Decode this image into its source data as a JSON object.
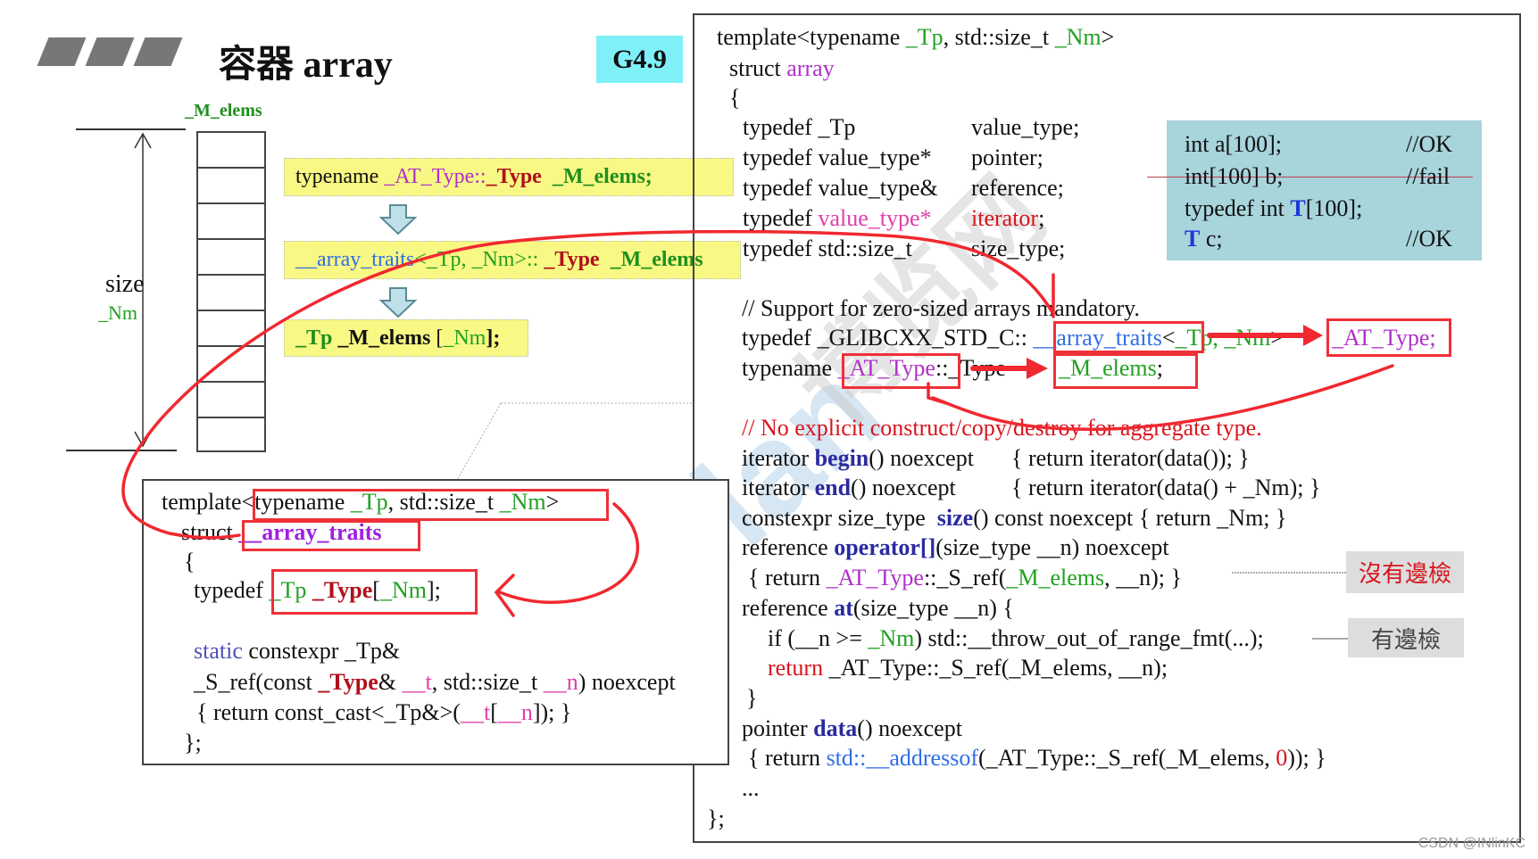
{
  "header": {
    "title": "容器 array",
    "version_badge": "G4.9"
  },
  "diagram": {
    "elems_label": "_M_elems",
    "size_label": "size",
    "size_var": "_Nm",
    "cell_count": 9
  },
  "yellow_boxes": [
    [
      [
        "typename ",
        "k"
      ],
      [
        "_AT_Type::",
        "p"
      ],
      [
        "_Type",
        "drb"
      ],
      [
        "  ",
        "k"
      ],
      [
        "_M_elems;",
        "gb"
      ]
    ],
    [
      [
        "__array_traits",
        "lb"
      ],
      [
        "<_Tp, _Nm>:: ",
        "g"
      ],
      [
        "_Type",
        "drb"
      ],
      [
        "  ",
        "k"
      ],
      [
        "_M_elems",
        "gb"
      ]
    ],
    [
      [
        "_Tp",
        "gb"
      ],
      [
        " _M_elems ",
        "kb"
      ],
      [
        "[",
        "k"
      ],
      [
        "_Nm",
        "g"
      ],
      [
        "];",
        "kb"
      ]
    ]
  ],
  "left_code": {
    "lines": [
      [
        [
          "template<typename ",
          "k"
        ],
        [
          "_Tp",
          "g"
        ],
        [
          ", std::size_t ",
          "k"
        ],
        [
          "_Nm",
          "g"
        ],
        [
          ">",
          "k"
        ]
      ],
      [
        [
          "struct ",
          "k"
        ],
        [
          "__array_traits",
          "pb"
        ]
      ],
      [
        [
          "{",
          "k"
        ]
      ],
      [
        [
          "typedef ",
          "k"
        ],
        [
          "_Tp ",
          "g"
        ],
        [
          "_Type",
          "drb"
        ],
        [
          "[",
          "k"
        ],
        [
          "_Nm",
          "g"
        ],
        [
          "];",
          "k"
        ]
      ],
      [
        [
          "static",
          "pu"
        ],
        [
          " constexpr _Tp&",
          "k"
        ]
      ],
      [
        [
          "_S_ref(const ",
          "k"
        ],
        [
          "_Type",
          "drb"
        ],
        [
          "& ",
          "k"
        ],
        [
          "__t",
          "pk"
        ],
        [
          ", std::size_t ",
          "k"
        ],
        [
          "__n",
          "pk"
        ],
        [
          ") noexcept",
          "k"
        ]
      ],
      [
        [
          "{ return const_cast<_Tp&>(",
          "k"
        ],
        [
          "__t",
          "pk"
        ],
        [
          "[",
          "k"
        ],
        [
          "__n",
          "pk"
        ],
        [
          "]); }",
          "k"
        ]
      ],
      [
        [
          "};",
          "k"
        ]
      ]
    ]
  },
  "right_code": {
    "lines": [
      [
        [
          "template<typename ",
          "k"
        ],
        [
          "_Tp",
          "g"
        ],
        [
          ", std::size_t ",
          "k"
        ],
        [
          "_Nm",
          "g"
        ],
        [
          ">",
          "k"
        ]
      ],
      [
        [
          "struct ",
          "k"
        ],
        [
          "array",
          "p"
        ]
      ],
      [
        [
          "{",
          "k"
        ]
      ],
      [
        [
          "typedef _Tp",
          "k"
        ]
      ],
      [
        [
          "value_type;",
          "k"
        ]
      ],
      [
        [
          "typedef value_type*",
          "k"
        ]
      ],
      [
        [
          "pointer;",
          "k"
        ]
      ],
      [
        [
          "typedef value_type&",
          "k"
        ]
      ],
      [
        [
          "reference;",
          "k"
        ]
      ],
      [
        [
          "typedef ",
          "k"
        ],
        [
          "value_type*",
          "pk"
        ]
      ],
      [
        [
          "iterator",
          "r"
        ],
        [
          ";",
          "k"
        ]
      ],
      [
        [
          "typedef std::size_t",
          "k"
        ]
      ],
      [
        [
          "size_type;",
          "k"
        ]
      ],
      [
        [
          "// Support for zero-sized arrays mandatory.",
          "k"
        ]
      ],
      [
        [
          "typedef _GLIBCXX_STD_C:: ",
          "k"
        ],
        [
          "__array_traits",
          "lb"
        ],
        [
          "<",
          "k"
        ],
        [
          "_Tp, _Nm",
          "g"
        ],
        [
          ">",
          "k"
        ]
      ],
      [
        [
          "_AT_Type;",
          "p"
        ]
      ],
      [
        [
          "typename ",
          "k"
        ],
        [
          "_AT_Type",
          "p"
        ],
        [
          "::_Type",
          "k"
        ]
      ],
      [
        [
          "_M_elems",
          "g"
        ],
        [
          ";",
          "k"
        ]
      ],
      [
        [
          "// No explicit construct/copy/destroy for aggregate type.",
          "r"
        ]
      ],
      [
        [
          "iterator ",
          "k"
        ],
        [
          "begin",
          "b"
        ],
        [
          "() noexcept",
          "k"
        ]
      ],
      [
        [
          "{ return iterator(data()); }",
          "k"
        ]
      ],
      [
        [
          "iterator ",
          "k"
        ],
        [
          "end",
          "b"
        ],
        [
          "() noexcept",
          "k"
        ]
      ],
      [
        [
          "{ return iterator(data() + _Nm); }",
          "k"
        ]
      ],
      [
        [
          "constexpr size_type  ",
          "k"
        ],
        [
          "size",
          "b"
        ],
        [
          "() const noexcept { return _Nm; }",
          "k"
        ]
      ],
      [
        [
          "reference ",
          "k"
        ],
        [
          "operator[]",
          "b"
        ],
        [
          "(size_type __n) noexcept",
          "k"
        ]
      ],
      [
        [
          "{ return ",
          "k"
        ],
        [
          "_AT_Type",
          "p"
        ],
        [
          "::_S_ref(",
          "k"
        ],
        [
          "_M_elems",
          "g"
        ],
        [
          ", __n); }",
          "k"
        ]
      ],
      [
        [
          "reference ",
          "k"
        ],
        [
          "at",
          "b"
        ],
        [
          "(size_type __n) {",
          "k"
        ]
      ],
      [
        [
          "if (__n >= ",
          "k"
        ],
        [
          "_Nm",
          "g"
        ],
        [
          ") std::__throw_out_of_range_fmt(...);",
          "k"
        ]
      ],
      [
        [
          "return",
          "r"
        ],
        [
          " _AT_Type::_S_ref(_M_elems, __n);",
          "k"
        ]
      ],
      [
        [
          "}",
          "k"
        ]
      ],
      [
        [
          "pointer ",
          "k"
        ],
        [
          "data",
          "b"
        ],
        [
          "() noexcept",
          "k"
        ]
      ],
      [
        [
          "{ return ",
          "k"
        ],
        [
          "std::__addressof",
          "lb"
        ],
        [
          "(_AT_Type::_S_ref(_M_elems, ",
          "k"
        ],
        [
          "0",
          "r"
        ],
        [
          ")); }",
          "k"
        ]
      ],
      [
        [
          "...",
          "k"
        ]
      ],
      [
        [
          "};",
          "k"
        ]
      ]
    ]
  },
  "note_box": {
    "lines": [
      [
        [
          "int a[100];",
          "k"
        ]
      ],
      [
        [
          "//OK",
          "k"
        ]
      ],
      [
        [
          "int[100] b;",
          "k"
        ]
      ],
      [
        [
          "//fail",
          "k"
        ]
      ],
      [
        [
          "typedef int ",
          "k"
        ],
        [
          "T",
          "tb"
        ],
        [
          "[100];",
          "k"
        ]
      ],
      [
        [
          "T",
          "tb"
        ],
        [
          " c;",
          "k"
        ]
      ],
      [
        [
          "//OK",
          "k"
        ]
      ]
    ]
  },
  "labels": {
    "no_bounds_check": "沒有邊檢",
    "bounds_check": "有邊檢"
  },
  "watermark": {
    "brand": "Boolan",
    "site": "博览网"
  },
  "credit": "CSDN @INlinKC",
  "colors": {
    "annotation_red": "#f03038",
    "badge_cyan": "#7ff0f8",
    "highlight_yellow": "#f8f884",
    "note_blue": "#a8d4dc"
  }
}
